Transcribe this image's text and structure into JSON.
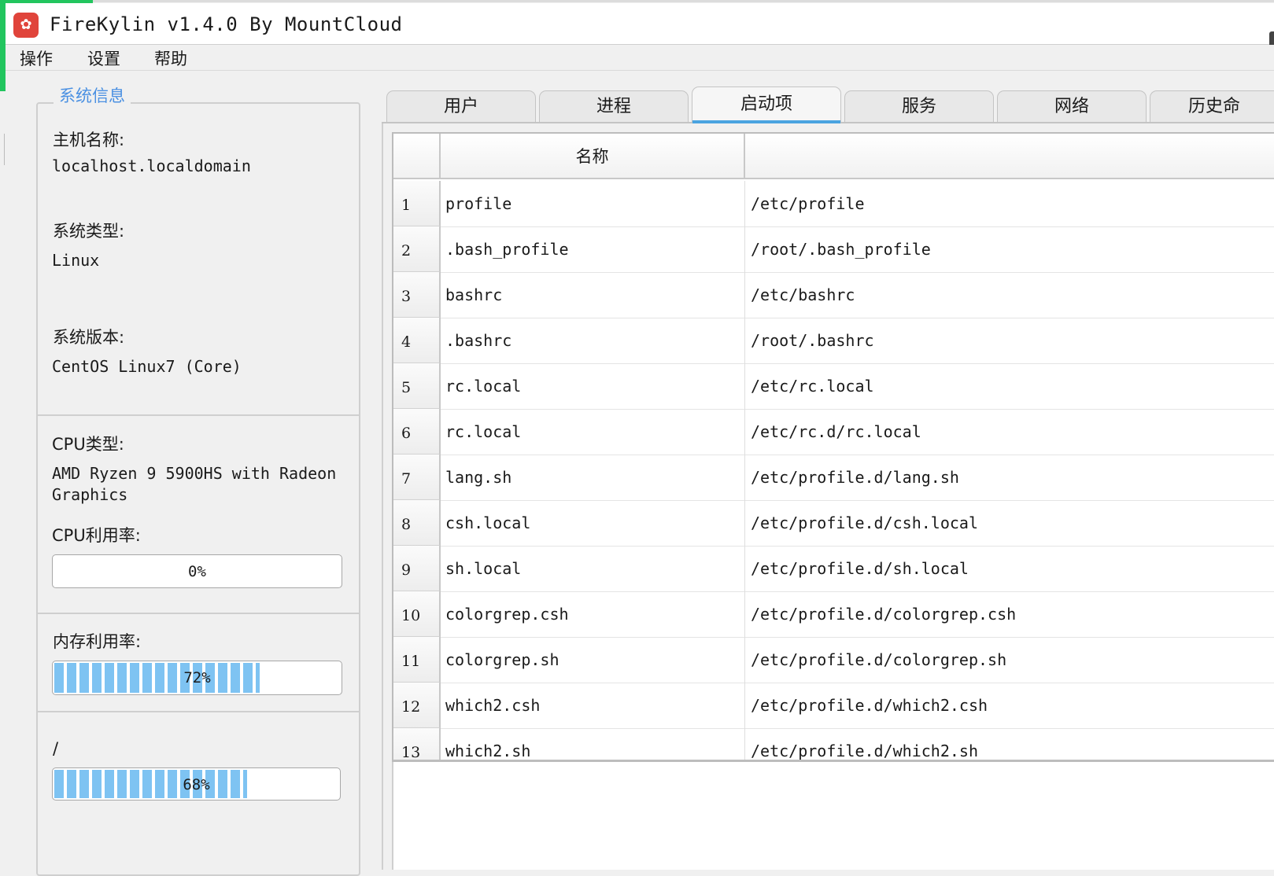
{
  "window": {
    "title": "FireKylin v1.4.0 By MountCloud"
  },
  "menu": {
    "items": [
      "操作",
      "设置",
      "帮助"
    ]
  },
  "sysinfo": {
    "legend": "系统信息",
    "hostname_label": "主机名称:",
    "hostname": "localhost.localdomain",
    "ostype_label": "系统类型:",
    "ostype": "Linux",
    "osver_label": "系统版本:",
    "osver": "CentOS Linux7 (Core)",
    "cpu_type_label": "CPU类型:",
    "cpu_type_line1": "AMD Ryzen 9 5900HS with Radeon",
    "cpu_type_line2": "Graphics",
    "cpu_usage_label": "CPU利用率:",
    "cpu_usage_text": "0%",
    "cpu_usage": 0.0,
    "mem_label": "内存利用率:",
    "mem_usage_text": "72%",
    "mem_usage": 0.72,
    "disk_label": "/",
    "disk_usage_text": "68%",
    "disk_usage": 0.68
  },
  "tabs": [
    {
      "label": "用户",
      "active": false
    },
    {
      "label": "进程",
      "active": false
    },
    {
      "label": "启动项",
      "active": true
    },
    {
      "label": "服务",
      "active": false
    },
    {
      "label": "网络",
      "active": false
    },
    {
      "label": "历史命",
      "active": false
    }
  ],
  "table": {
    "col_name": "名称",
    "col_path": "",
    "rows": [
      {
        "num": "1",
        "name": "profile",
        "path": "/etc/profile"
      },
      {
        "num": "2",
        "name": ".bash_profile",
        "path": "/root/.bash_profile"
      },
      {
        "num": "3",
        "name": "bashrc",
        "path": "/etc/bashrc"
      },
      {
        "num": "4",
        "name": ".bashrc",
        "path": "/root/.bashrc"
      },
      {
        "num": "5",
        "name": "rc.local",
        "path": "/etc/rc.local"
      },
      {
        "num": "6",
        "name": "rc.local",
        "path": "/etc/rc.d/rc.local"
      },
      {
        "num": "7",
        "name": "lang.sh",
        "path": "/etc/profile.d/lang.sh"
      },
      {
        "num": "8",
        "name": "csh.local",
        "path": "/etc/profile.d/csh.local"
      },
      {
        "num": "9",
        "name": "sh.local",
        "path": "/etc/profile.d/sh.local"
      },
      {
        "num": "10",
        "name": "colorgrep.csh",
        "path": "/etc/profile.d/colorgrep.csh"
      },
      {
        "num": "11",
        "name": "colorgrep.sh",
        "path": "/etc/profile.d/colorgrep.sh"
      },
      {
        "num": "12",
        "name": "which2.csh",
        "path": "/etc/profile.d/which2.csh"
      },
      {
        "num": "13",
        "name": "which2.sh",
        "path": "/etc/profile.d/which2.sh"
      }
    ]
  }
}
